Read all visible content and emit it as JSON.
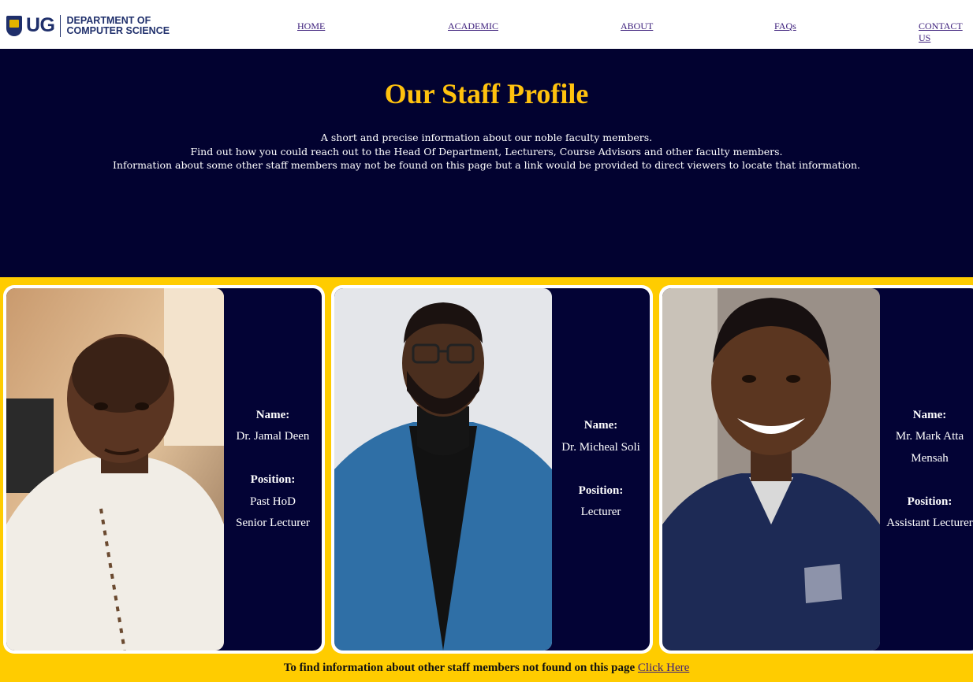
{
  "header": {
    "logo_text": "UG",
    "dept_line1": "DEPARTMENT OF",
    "dept_line2": "COMPUTER SCIENCE",
    "nav": [
      "HOME",
      "ACADEMIC",
      "ABOUT",
      "FAQs",
      "CONTACT US"
    ]
  },
  "hero": {
    "title": "Our Staff Profile",
    "lines": [
      "A short and precise information about our noble faculty members.",
      "Find out how you could reach out to the Head Of Department, Lecturers, Course Advisors and other faculty members.",
      "Information about some other staff members may not be found on this page but a link would be provided to direct viewers to locate that information."
    ]
  },
  "staff": [
    {
      "name_label": "Name:",
      "name": "Dr. Jamal Deen",
      "position_label": "Position:",
      "positions": [
        "Past HoD",
        "Senior Lecturer"
      ]
    },
    {
      "name_label": "Name:",
      "name": "Dr. Micheal Soli",
      "position_label": "Position:",
      "positions": [
        "Lecturer"
      ]
    },
    {
      "name_label": "Name:",
      "name": "Mr. Mark Atta Mensah",
      "position_label": "Position:",
      "positions": [
        "Assistant Lecturer"
      ]
    }
  ],
  "footer": {
    "text": "To find information about other staff members not found on this page",
    "link": "Click Here"
  },
  "colors": {
    "navy": "#020230",
    "gold": "#ffc20e",
    "yellow": "#ffcc00"
  }
}
